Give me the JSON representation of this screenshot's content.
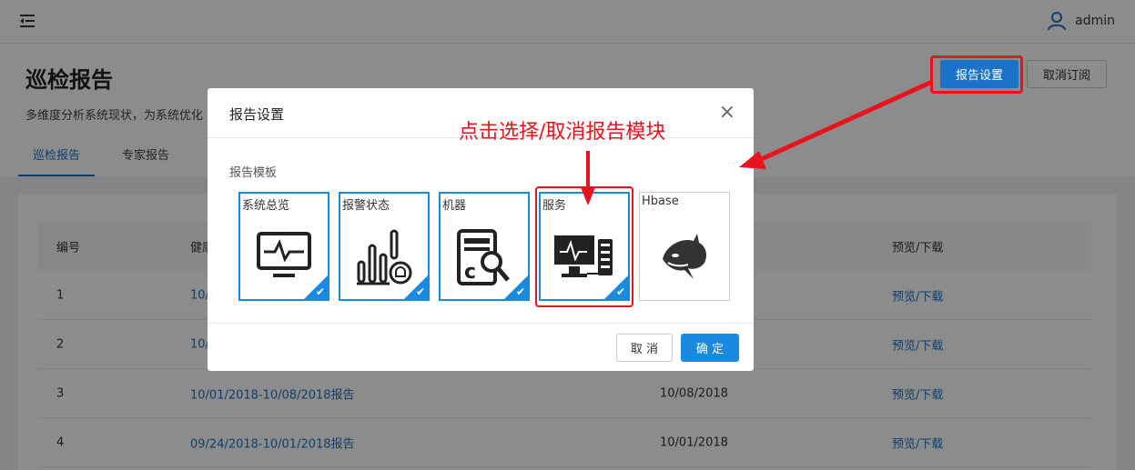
{
  "topbar": {
    "username": "admin"
  },
  "header": {
    "title": "巡检报告",
    "description": "多维度分析系统现状，为系统优化",
    "report_settings_label": "报告设置",
    "unsubscribe_label": "取消订阅",
    "tabs": [
      {
        "label": "巡检报告",
        "active": true
      },
      {
        "label": "专家报告",
        "active": false
      }
    ]
  },
  "table": {
    "columns": [
      "编号",
      "健康",
      "",
      "预览/下载"
    ],
    "rows": [
      {
        "id": "1",
        "name": "10/",
        "date": "",
        "action": "预览/下载"
      },
      {
        "id": "2",
        "name": "10/",
        "date": "",
        "action": "预览/下载"
      },
      {
        "id": "3",
        "name": "10/01/2018-10/08/2018报告",
        "date": "10/08/2018",
        "action": "预览/下载"
      },
      {
        "id": "4",
        "name": "09/24/2018-10/01/2018报告",
        "date": "10/01/2018",
        "action": "预览/下载"
      }
    ]
  },
  "modal": {
    "title": "报告设置",
    "close": "×",
    "section_label": "报告模板",
    "cards": [
      {
        "label": "系统总览",
        "icon": "monitor-icon",
        "selected": true
      },
      {
        "label": "报警状态",
        "icon": "alarm-chart-icon",
        "selected": true
      },
      {
        "label": "机器",
        "icon": "machine-search-icon",
        "selected": true
      },
      {
        "label": "服务",
        "icon": "service-server-icon",
        "selected": true
      },
      {
        "label": "Hbase",
        "icon": "hbase-orca-icon",
        "selected": false
      }
    ],
    "check": "✔",
    "cancel_label": "取 消",
    "ok_label": "确 定"
  },
  "annotation": {
    "text": "点击选择/取消报告模块"
  },
  "colors": {
    "primary": "#1a73c9",
    "accent": "#1a8ae0",
    "annotation": "#e8131c"
  }
}
